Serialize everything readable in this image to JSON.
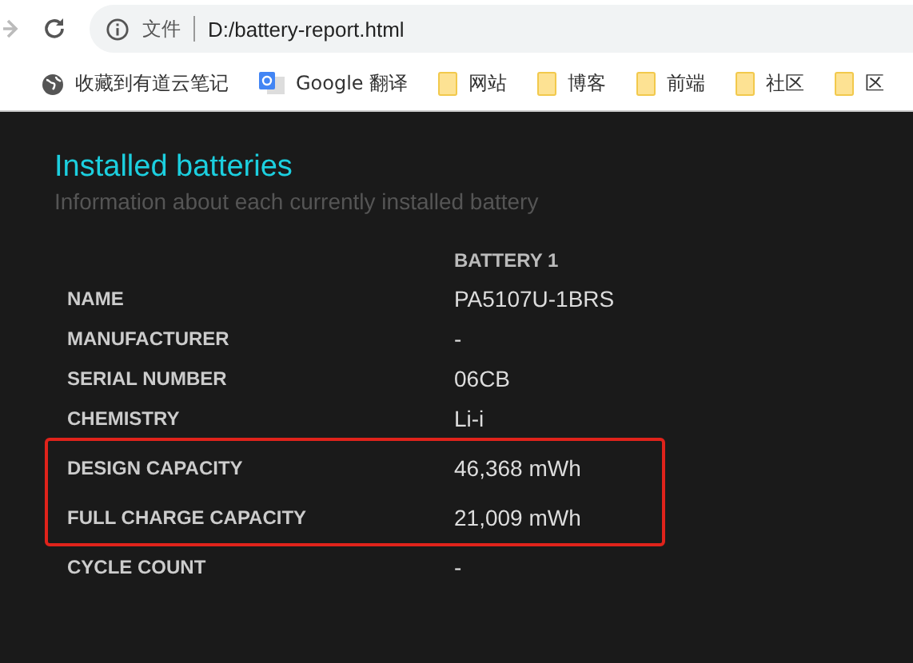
{
  "browser": {
    "address_label": "文件",
    "url": "D:/battery-report.html",
    "bookmarks": [
      {
        "kind": "globe",
        "label": "收藏到有道云笔记"
      },
      {
        "kind": "translate",
        "label": "Google 翻译"
      },
      {
        "kind": "folder",
        "label": "网站"
      },
      {
        "kind": "folder",
        "label": "博客"
      },
      {
        "kind": "folder",
        "label": "前端"
      },
      {
        "kind": "folder",
        "label": "社区"
      },
      {
        "kind": "folder",
        "label": "区"
      }
    ]
  },
  "section": {
    "title": "Installed batteries",
    "subtitle": "Information about each currently installed battery",
    "column_header": "BATTERY 1",
    "rows": [
      {
        "label": "NAME",
        "value": "PA5107U-1BRS",
        "highlighted": false
      },
      {
        "label": "MANUFACTURER",
        "value": "-",
        "highlighted": false
      },
      {
        "label": "SERIAL NUMBER",
        "value": "06CB",
        "highlighted": false
      },
      {
        "label": "CHEMISTRY",
        "value": "Li-i",
        "highlighted": false
      },
      {
        "label": "DESIGN CAPACITY",
        "value": "46,368 mWh",
        "highlighted": true
      },
      {
        "label": "FULL CHARGE CAPACITY",
        "value": "21,009 mWh",
        "highlighted": true
      },
      {
        "label": "CYCLE COUNT",
        "value": "-",
        "highlighted": false
      }
    ]
  }
}
